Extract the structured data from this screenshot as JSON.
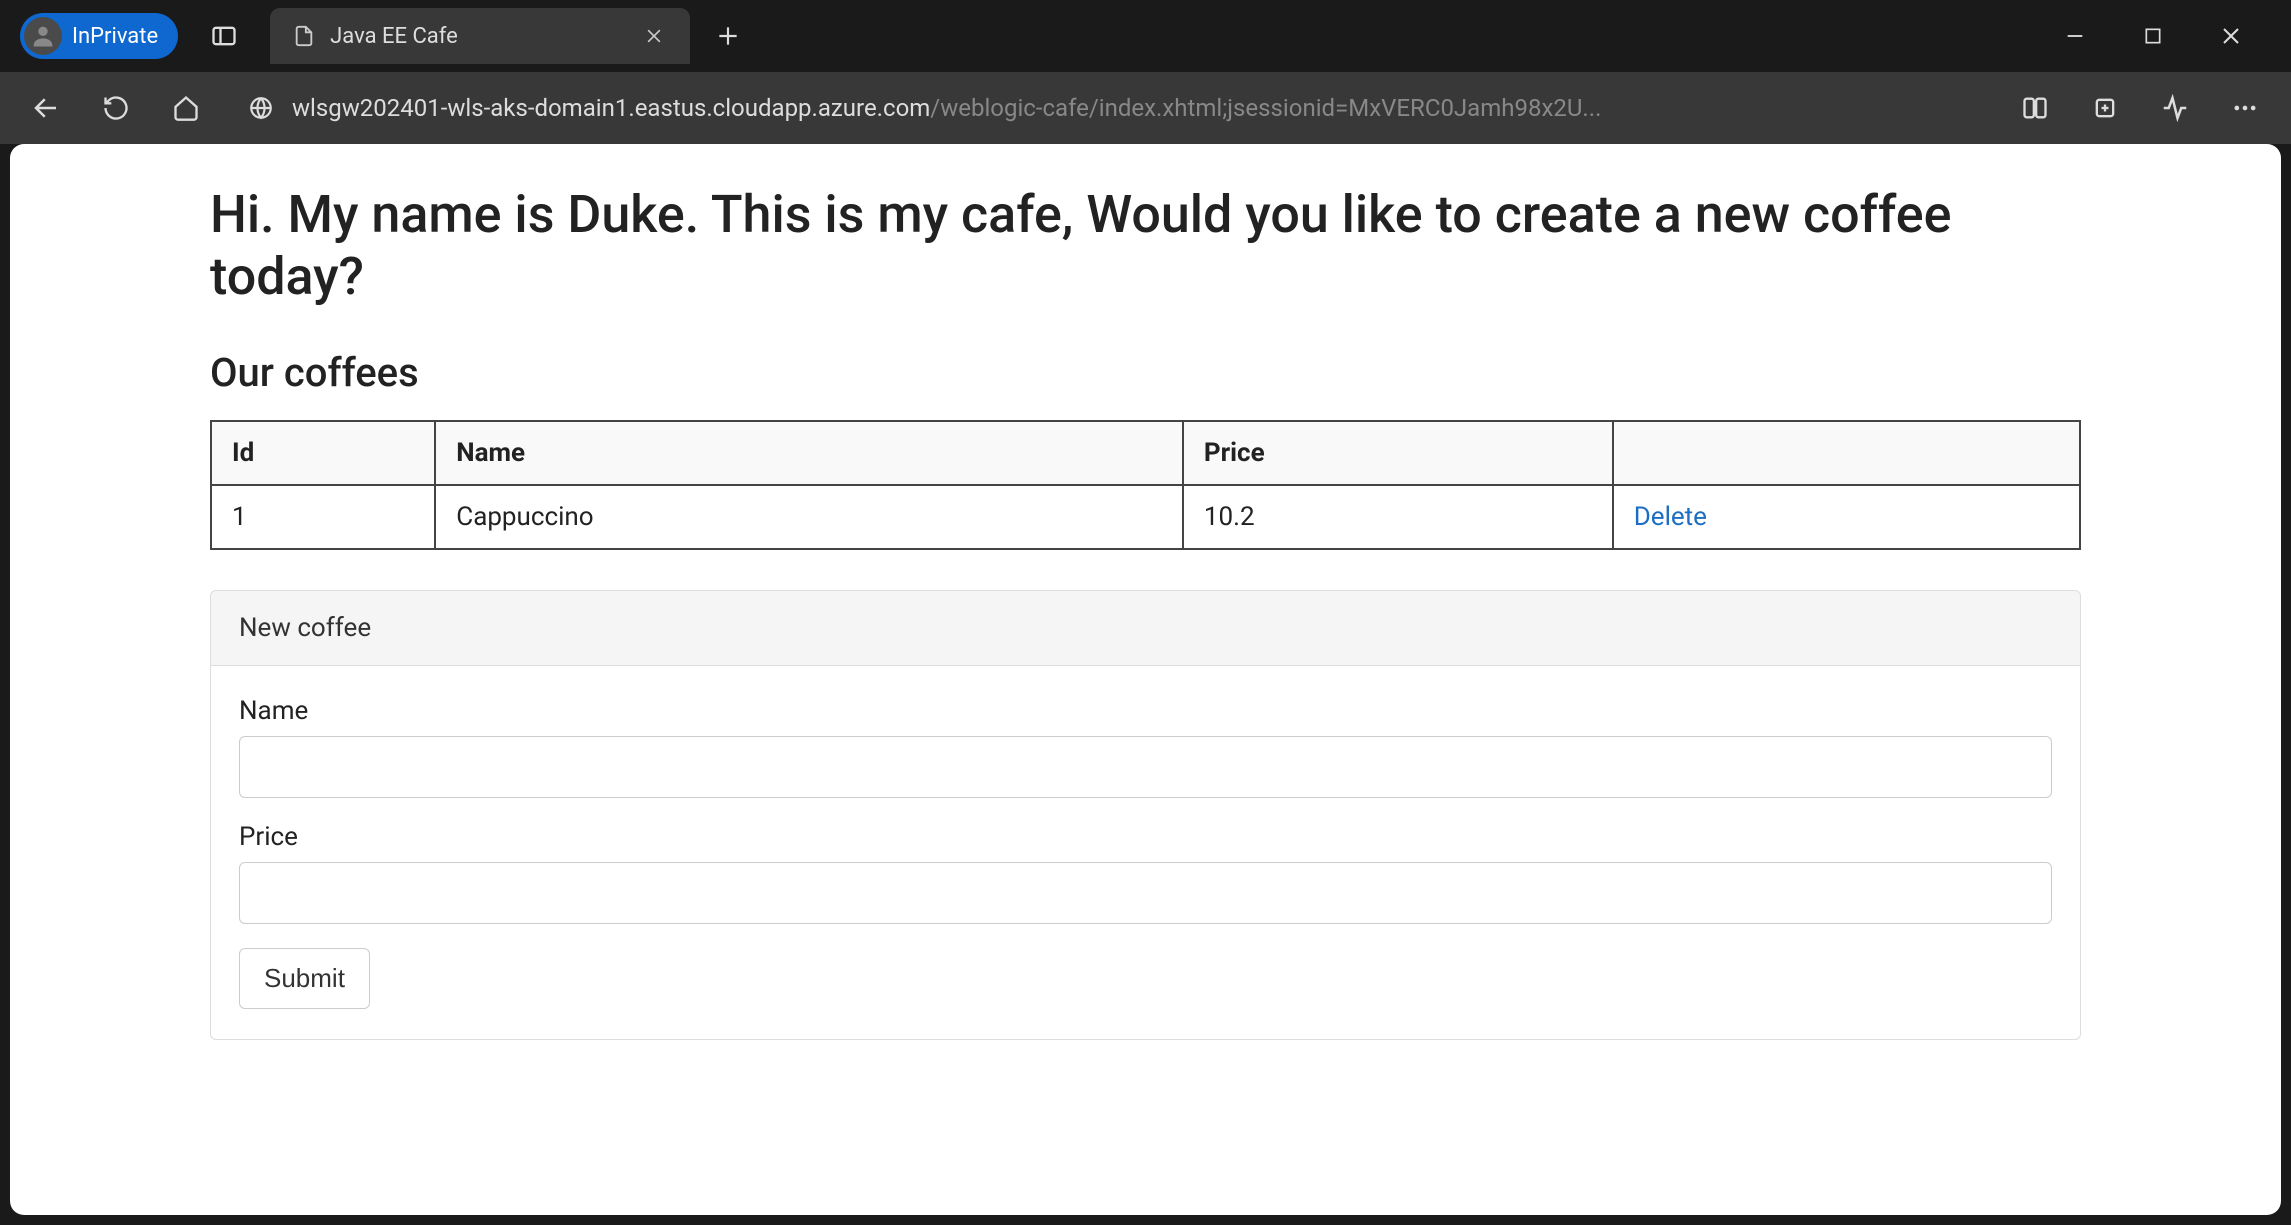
{
  "browser": {
    "inprivate_label": "InPrivate",
    "tab_title": "Java EE Cafe",
    "url_host": "wlsgw202401-wls-aks-domain1.eastus.cloudapp.azure.com",
    "url_path": "/weblogic-cafe/index.xhtml;jsessionid=MxVERC0Jamh98x2U..."
  },
  "page": {
    "heading": "Hi. My name is Duke. This is my cafe, Would you like to create a new coffee today?",
    "subheading": "Our coffees",
    "table": {
      "headers": [
        "Id",
        "Name",
        "Price",
        ""
      ],
      "rows": [
        {
          "id": "1",
          "name": "Cappuccino",
          "price": "10.2",
          "action": "Delete"
        }
      ]
    },
    "form": {
      "panel_title": "New coffee",
      "name_label": "Name",
      "name_value": "",
      "price_label": "Price",
      "price_value": "",
      "submit_label": "Submit"
    }
  }
}
